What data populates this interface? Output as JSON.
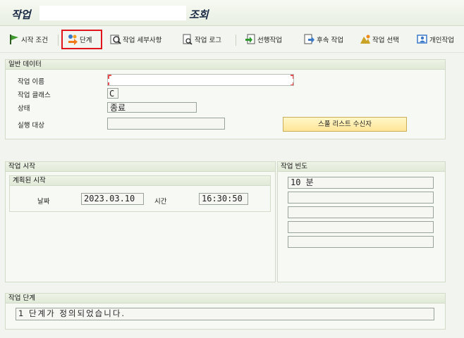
{
  "title": {
    "prefix": "작업",
    "suffix": "조회"
  },
  "toolbar": {
    "start_cond": "시작 조건",
    "steps": "단계",
    "job_details": "작업 세부사항",
    "job_log": "작업 로그",
    "predecessor": "선행작업",
    "successor": "후속 작업",
    "job_select": "작업 선택",
    "own_jobs": "개인작업"
  },
  "general": {
    "header": "일반 데이터",
    "job_name_label": "작업 이름",
    "job_class_label": "작업 클래스",
    "job_class_value": "C",
    "status_label": "상태",
    "status_value": "종료",
    "exec_target_label": "실행 대상",
    "exec_target_value": "",
    "spool_button": "스풀 리스트 수신자"
  },
  "start": {
    "header": "작업 시작",
    "planned_header": "계획된 시작",
    "date_label": "날짜",
    "date_value": "2023.03.10",
    "time_label": "시간",
    "time_value": "16:30:50"
  },
  "frequency": {
    "header": "작업 빈도",
    "rows": [
      "10 분",
      "",
      "",
      "",
      ""
    ]
  },
  "steps": {
    "header": "작업 단계",
    "message": "1 단계가 정의되었습니다."
  },
  "icons": [
    "flag-icon",
    "steps-icon",
    "job-details-icon",
    "job-log-icon",
    "predecessor-icon",
    "successor-icon",
    "job-select-icon",
    "own-jobs-icon"
  ],
  "colors": {
    "highlight": "#e0161c",
    "button_bg": "#ffe597",
    "group_header": "#e1e9d7"
  }
}
